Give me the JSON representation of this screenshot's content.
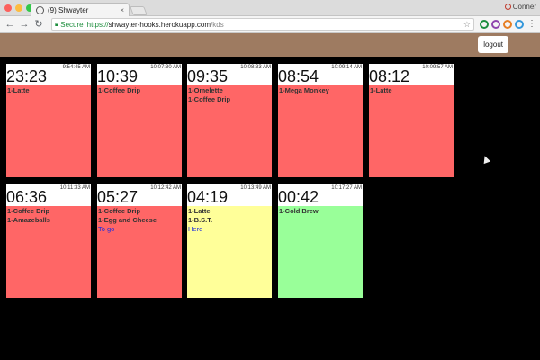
{
  "browser": {
    "tab_title": "(9) Shwayter",
    "tab_close": "×",
    "profile_label": "Conner",
    "address_secure_label": "Secure",
    "url_scheme": "https://",
    "url_host": "shwayter-hooks.herokuapp.com",
    "url_path": "/kds",
    "traffic_light_colors": [
      "#fc615d",
      "#fdbc40",
      "#34c84a"
    ],
    "extension_colors": [
      "#1b8e3e",
      "#8e44ad",
      "#e67e22",
      "#3498db",
      "#e74c3c"
    ]
  },
  "header": {
    "logout_label": "logout",
    "color": "#9e7b61"
  },
  "status_colors": {
    "late": "#ff6666",
    "in_progress": "#ffff99",
    "ready": "#99ff99"
  },
  "orders": [
    {
      "timer": "23:23",
      "time": "9:54:45 AM",
      "status": "late",
      "items": [
        "1-Latte"
      ],
      "note": ""
    },
    {
      "timer": "10:39",
      "time": "10:07:30 AM",
      "status": "late",
      "items": [
        "1-Coffee Drip"
      ],
      "note": ""
    },
    {
      "timer": "09:35",
      "time": "10:08:33 AM",
      "status": "late",
      "items": [
        "1-Omelette",
        "1-Coffee Drip"
      ],
      "note": ""
    },
    {
      "timer": "08:54",
      "time": "10:09:14 AM",
      "status": "late",
      "items": [
        "1-Mega Monkey"
      ],
      "note": ""
    },
    {
      "timer": "08:12",
      "time": "10:09:57 AM",
      "status": "late",
      "items": [
        "1-Latte"
      ],
      "note": ""
    },
    {
      "timer": "06:36",
      "time": "10:11:33 AM",
      "status": "late",
      "items": [
        "1-Coffee Drip",
        "1-Amazeballs"
      ],
      "note": ""
    },
    {
      "timer": "05:27",
      "time": "10:12:42 AM",
      "status": "late",
      "items": [
        "1-Coffee Drip",
        "1-Egg and Cheese"
      ],
      "note": "To go"
    },
    {
      "timer": "04:19",
      "time": "10:13:49 AM",
      "status": "in_progress",
      "items": [
        "1-Latte",
        "1-B.S.T."
      ],
      "note": "Here"
    },
    {
      "timer": "00:42",
      "time": "10:17:27 AM",
      "status": "ready",
      "items": [
        "1-Cold Brew"
      ],
      "note": ""
    }
  ]
}
